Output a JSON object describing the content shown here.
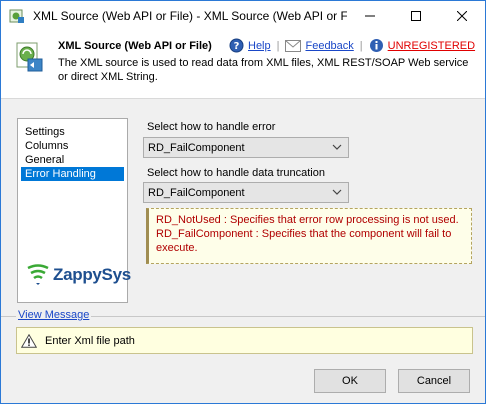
{
  "window": {
    "title": "XML Source (Web API or File) - XML Source (Web API or Fi..."
  },
  "header": {
    "title": "XML Source (Web API or File)",
    "help_label": "Help",
    "feedback_label": "Feedback",
    "unregistered_label": "UNREGISTERED",
    "description": "The XML source is used to read data from XML files, XML REST/SOAP Web service or direct XML String."
  },
  "nav": {
    "items": [
      {
        "label": "Settings"
      },
      {
        "label": "Columns"
      },
      {
        "label": "General"
      },
      {
        "label": "Error Handling"
      }
    ],
    "selected": "Error Handling"
  },
  "logo": {
    "text": "ZappySys"
  },
  "error_handling": {
    "error_label": "Select how to handle error",
    "error_value": "RD_FailComponent",
    "truncation_label": "Select how to handle data truncation",
    "truncation_value": "RD_FailComponent",
    "info_line1": "RD_NotUsed : Specifies that error row processing is not used.",
    "info_line2": "RD_FailComponent : Specifies that the component will fail to execute."
  },
  "view_message": {
    "label": "View Message",
    "message": "Enter Xml file path"
  },
  "buttons": {
    "ok": "OK",
    "cancel": "Cancel"
  },
  "colors": {
    "accent": "#0078d7",
    "link": "#1a47c7",
    "unregistered": "#e00000",
    "info_text": "#b00000"
  },
  "icons": [
    "app-icon",
    "minimize-icon",
    "maximize-icon",
    "close-icon",
    "xml-source-icon",
    "help-icon",
    "feedback-icon",
    "info-icon",
    "zappysys-logo-icon",
    "chevron-down-icon",
    "warning-icon"
  ]
}
